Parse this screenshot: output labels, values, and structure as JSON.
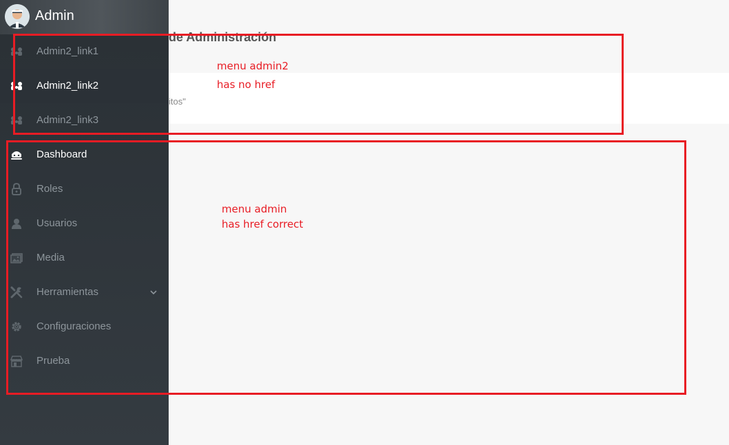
{
  "brand": {
    "name": "Admin",
    "avatar_icon": "user-avatar-icon"
  },
  "main": {
    "page_title_fragment": "de Administración",
    "info_text_fragment": "itos\""
  },
  "sidebar": {
    "items": [
      {
        "label": "Admin2_link1",
        "icon": "cluster-icon",
        "active": false
      },
      {
        "label": "Admin2_link2",
        "icon": "cluster-icon",
        "active": true
      },
      {
        "label": "Admin2_link3",
        "icon": "cluster-icon",
        "active": false
      },
      {
        "label": "Dashboard",
        "icon": "dashboard-icon",
        "active": false
      },
      {
        "label": "Roles",
        "icon": "lock-icon",
        "active": false
      },
      {
        "label": "Usuarios",
        "icon": "user-icon",
        "active": false
      },
      {
        "label": "Media",
        "icon": "image-icon",
        "active": false
      },
      {
        "label": "Herramientas",
        "icon": "tools-icon",
        "active": false,
        "has_submenu": true
      },
      {
        "label": "Configuraciones",
        "icon": "gear-icon",
        "active": false
      },
      {
        "label": "Prueba",
        "icon": "store-icon",
        "active": false
      }
    ]
  },
  "annotations": {
    "box1": {
      "line1": "menu admin2",
      "line2": "has no href"
    },
    "box2": {
      "line1": "menu admin",
      "line2": "has href correct"
    }
  },
  "colors": {
    "annotation": "#e81c24",
    "sidebar_bg": "#2f353a",
    "active_item": "#2b3137",
    "inactive_text": "#8d959b"
  }
}
